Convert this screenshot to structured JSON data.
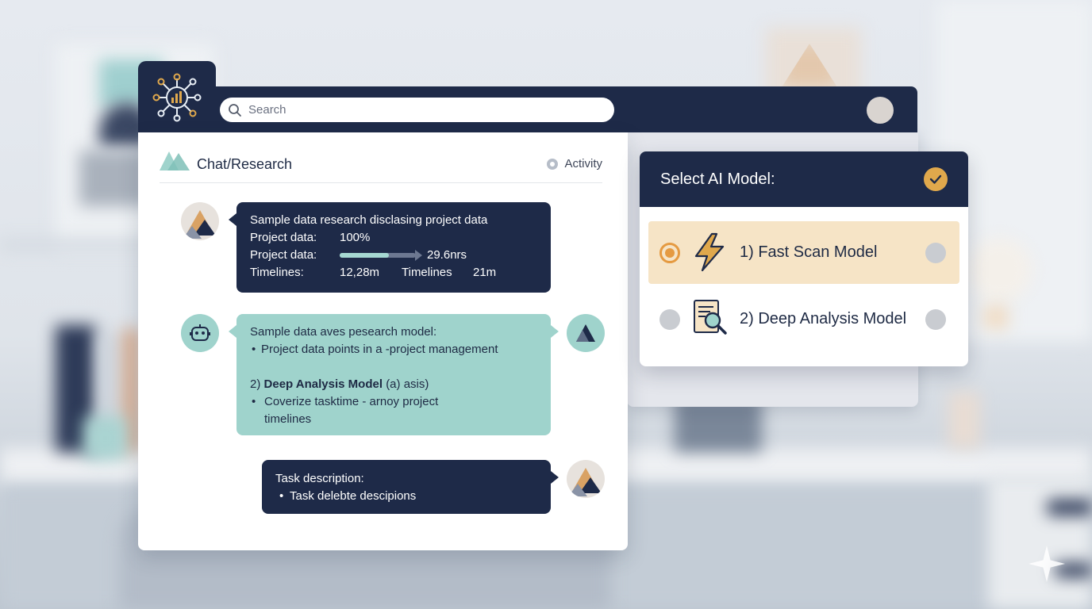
{
  "search": {
    "placeholder": "Search"
  },
  "chat": {
    "title": "Chat/Research",
    "activity_label": "Activity",
    "message1": {
      "line1": "Sample data research disclasing project data",
      "row1_label": "Project data:",
      "row1_value": "100%",
      "row2_label": "Project data:",
      "row2_progress": 0.65,
      "row2_value": "29.6nrs",
      "row3_label": "Timelines:",
      "row3_value": "12,28m",
      "row3_label2": "Timelines",
      "row3_value2": "21m"
    },
    "message2": {
      "line1": "Sample data aves pesearch model:",
      "bullet1": "Project data points in a -project management",
      "model_prefix": "2)",
      "model_name": "Deep Analysis Model",
      "model_suffix": "(a) asis)",
      "bullet2": "Coverize tasktime - arnoy project timelines"
    },
    "message3": {
      "line1": "Task description:",
      "bullet1": "Task delebte descipions"
    }
  },
  "model_selector": {
    "title": "Select AI Model:",
    "options": [
      {
        "label": "1) Fast Scan Model",
        "icon": "lightning-icon",
        "selected": true
      },
      {
        "label": "2) Deep Analysis Model",
        "icon": "document-magnifier-icon",
        "selected": false
      }
    ]
  },
  "colors": {
    "navy": "#1e2a48",
    "teal": "#9fd3cc",
    "accent_orange": "#e59a41",
    "selected_bg": "#f6e4c6"
  }
}
